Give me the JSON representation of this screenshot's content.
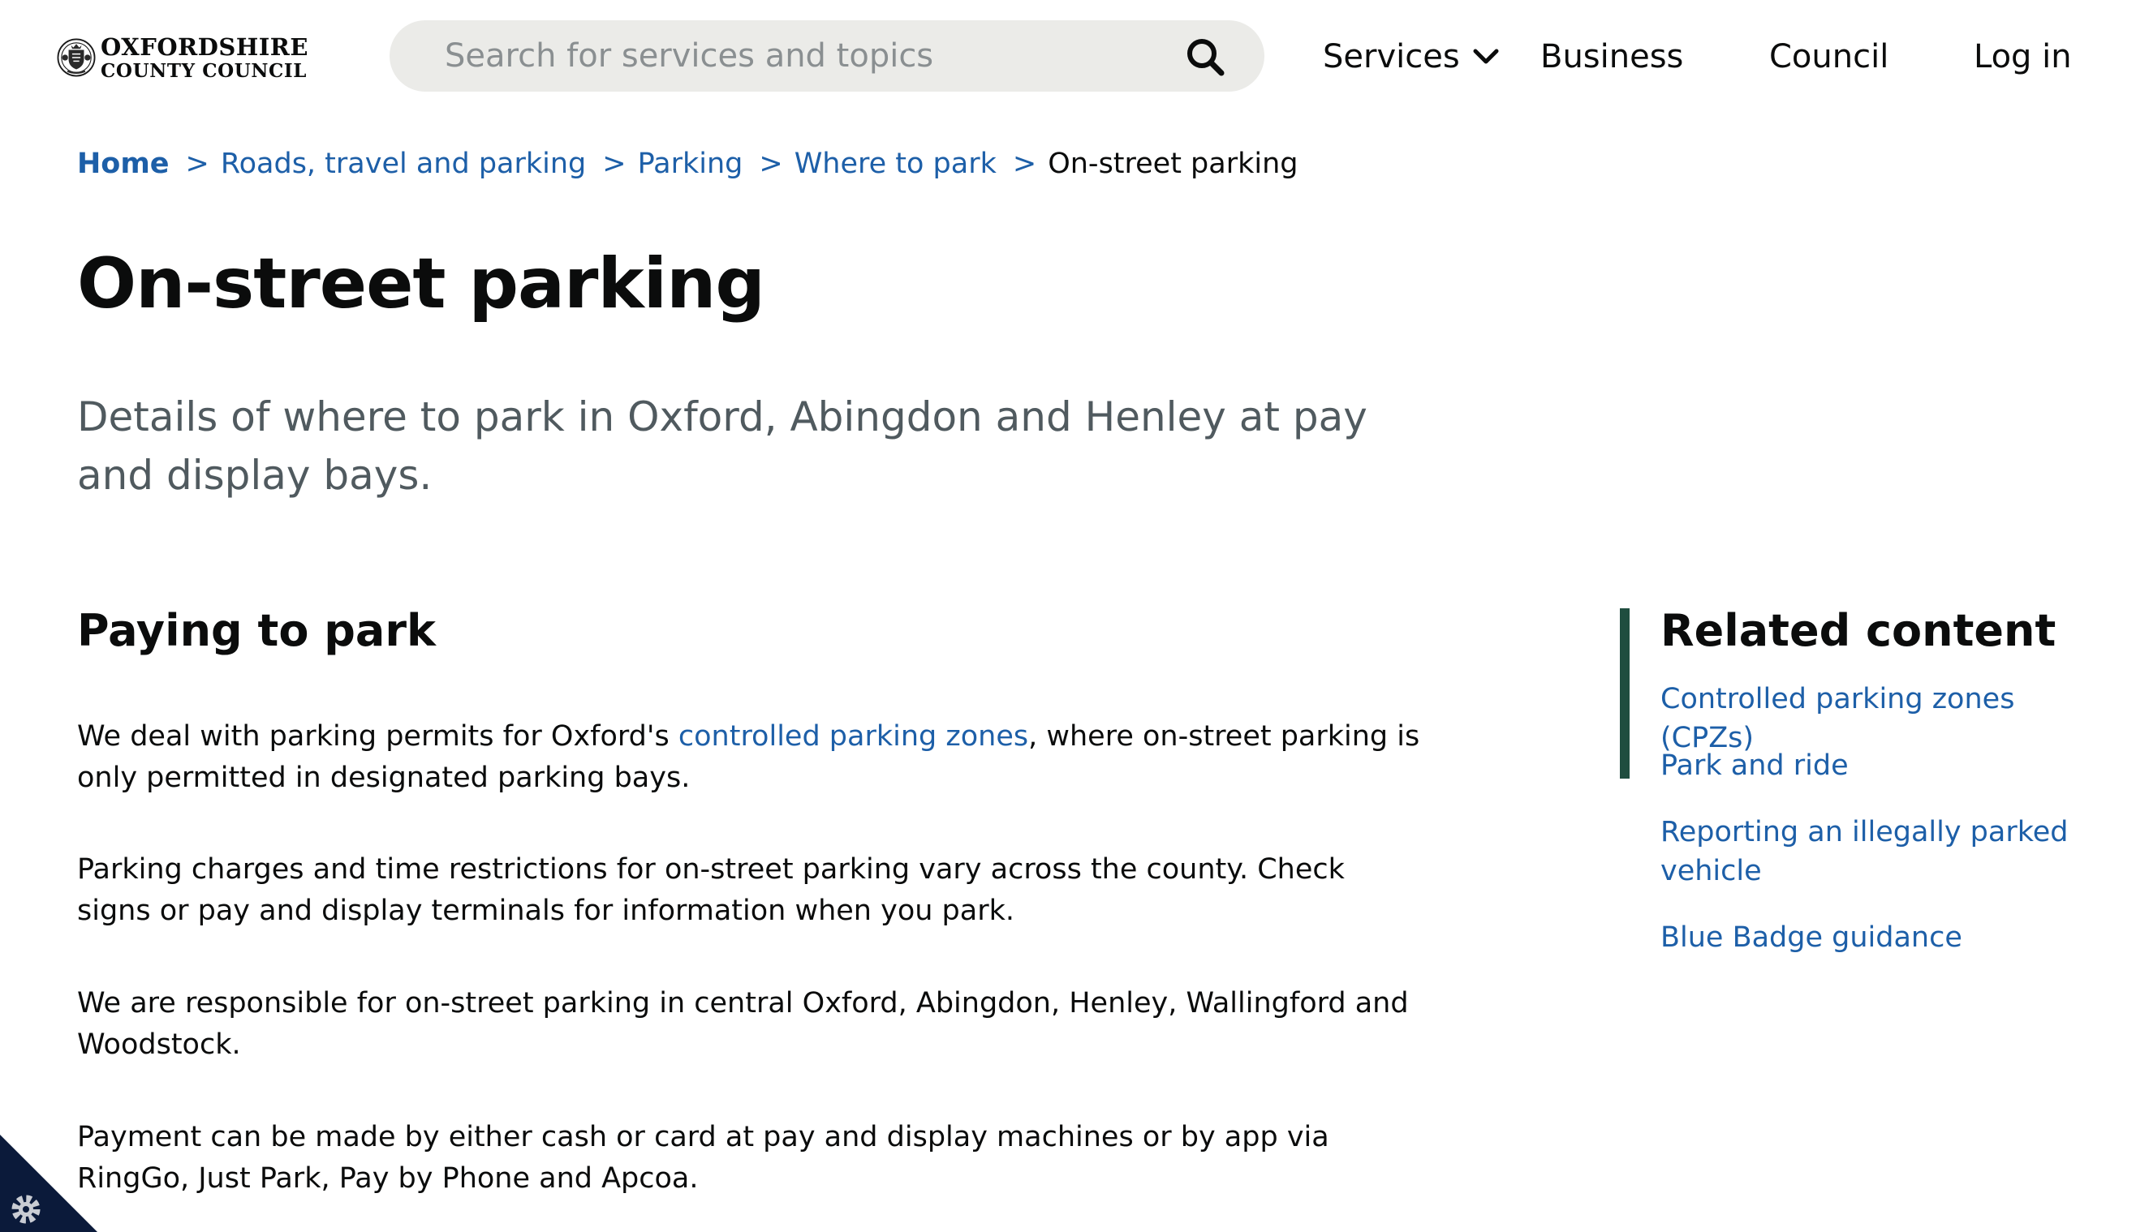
{
  "header": {
    "logo": {
      "line1": "OXFORDSHIRE",
      "line2": "COUNTY COUNCIL"
    },
    "search": {
      "placeholder": "Search for services and topics"
    },
    "nav": {
      "services": "Services",
      "business": "Business",
      "council": "Council",
      "login": "Log in"
    }
  },
  "breadcrumb": {
    "items": [
      "Home",
      "Roads, travel and parking",
      "Parking",
      "Where to park"
    ],
    "separator": ">",
    "current": "On-street parking"
  },
  "page": {
    "title": "On-street parking",
    "lede": "Details of where to park in Oxford, Abingdon and Henley at pay and display bays."
  },
  "main": {
    "heading": "Paying to park",
    "p1_before": "We deal with parking permits for Oxford's ",
    "p1_link": "controlled parking zones",
    "p1_after": ", where on-street parking is only permitted in designated parking bays.",
    "p2": "Parking charges and time restrictions for on-street parking vary across the county. Check signs or pay and display terminals for information when you park.",
    "p3": "We are responsible for on-street parking in central Oxford, Abingdon, Henley, Wallingford and Woodstock.",
    "p4": "Payment can be made by either cash or card at pay and display machines or by app via RingGo, Just Park, Pay by Phone and Apcoa."
  },
  "related": {
    "heading": "Related content",
    "links": [
      "Controlled parking zones (CPZs)",
      "Park and ride",
      "Reporting an illegally parked vehicle",
      "Blue Badge guidance"
    ]
  },
  "colors": {
    "link": "#1d5fa8",
    "accent_bar": "#1f4d3f",
    "corner": "#0b1a3a",
    "search_bg": "#ebebe8"
  },
  "icons": {
    "search": "search-icon",
    "chevron": "chevron-down-icon",
    "settings": "gear-icon",
    "crest": "council-crest-icon"
  }
}
